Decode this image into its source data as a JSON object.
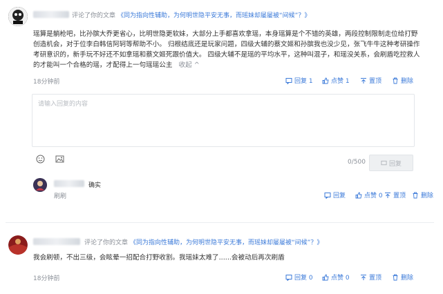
{
  "comment1": {
    "action_text": "评论了你的文章",
    "article_title": "《同为指向性辅助，为何明世隐平安无事，而瑶妹却屡屡被“间候”？》",
    "body": "瑶算是躺枪吧，比孙膑大乔更省心，比明世隐更软妹，大部分上手都喜欢拿瑶，本身瑶算是个不错的英雄，两段控制限制走位给打野创造机会，对于位李白韩信阿轲等帮助不小。 归根结底还是玩家问题，四级大辅的蔡文姬和孙膑我也没少见，张飞牛牛这种考研操作考研意识的，新手玩不好还不如拿瑶和蔡文姬死跟价值大。 四级大辅不是瑶的平均水平，这种叫混子，和瑶没关系，会刷盾吃控救人的才能叫一个合格的瑶，才配得上一句瑶瑶公主",
    "collapse": "收起",
    "time": "18分钟前",
    "reply_label": "回复 1",
    "like_label": "点赞 1",
    "pin_label": "置顶",
    "delete_label": "删除",
    "reply_placeholder": "请输入回复的内容",
    "char_count": "0/500",
    "reply_button": "回复",
    "sub_reply": {
      "text": "确实",
      "sub_text": "刷刷",
      "reply_label": "回复",
      "like_label": "点赞 0",
      "pin_label": "置顶",
      "delete_label": "删除"
    }
  },
  "comment2": {
    "action_text": "评论了你的文章",
    "article_title": "《同为指向性辅助，为何明世隐平安无事，而瑶妹却屡屡被“间候”？》",
    "body": "我会刷顿，不出三级，会眩晕一招配合打野收割。我瑶妹太难了......会被动后再次刷盾",
    "time": "18分钟前",
    "reply_label": "回复 0",
    "like_label": "点赞 0",
    "pin_label": "置顶",
    "delete_label": "删除"
  },
  "colors": {
    "link": "#3b7ad9",
    "muted": "#8a8f97",
    "text": "#333333"
  },
  "icons": [
    "emoji-icon",
    "image-icon",
    "reply-icon",
    "like-icon",
    "pin-icon",
    "trash-icon",
    "sent-icon"
  ]
}
